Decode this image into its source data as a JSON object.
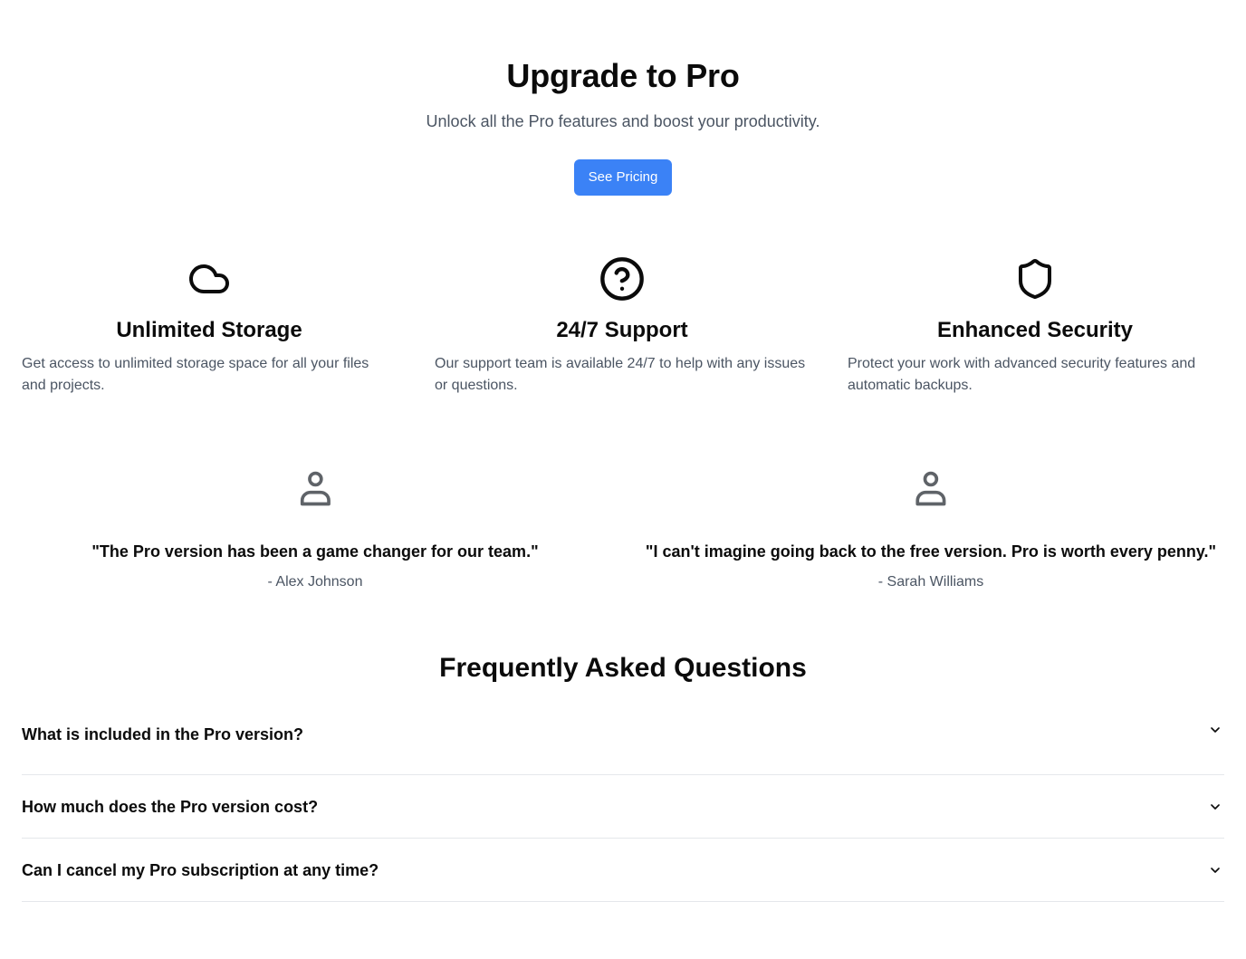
{
  "hero": {
    "title": "Upgrade to Pro",
    "subtitle": "Unlock all the Pro features and boost your productivity.",
    "cta_label": "See Pricing",
    "cta_color": "#3b82f6"
  },
  "features": [
    {
      "icon": "cloud-icon",
      "title": "Unlimited Storage",
      "description": "Get access to unlimited storage space for all your files and projects."
    },
    {
      "icon": "help-circle-icon",
      "title": "24/7 Support",
      "description": "Our support team is available 24/7 to help with any issues or questions."
    },
    {
      "icon": "shield-icon",
      "title": "Enhanced Security",
      "description": "Protect your work with advanced security features and automatic backups."
    }
  ],
  "testimonials": [
    {
      "icon": "user-icon",
      "quote": "\"The Pro version has been a game changer for our team.\"",
      "author": "- Alex Johnson"
    },
    {
      "icon": "user-icon",
      "quote": "\"I can't imagine going back to the free version. Pro is worth every penny.\"",
      "author": "- Sarah Williams"
    }
  ],
  "faq": {
    "title": "Frequently Asked Questions",
    "items": [
      {
        "question": "What is included in the Pro version?",
        "icon": "chevron-down-icon"
      },
      {
        "question": "How much does the Pro version cost?",
        "icon": "chevron-down-icon"
      },
      {
        "question": "Can I cancel my Pro subscription at any time?",
        "icon": "chevron-down-icon"
      }
    ]
  }
}
